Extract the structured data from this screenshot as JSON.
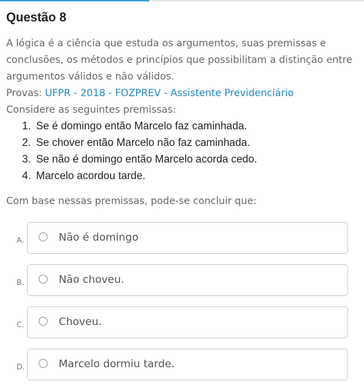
{
  "header": {
    "title": "Questão 8",
    "progress_fraction": 0.41
  },
  "question": {
    "intro": "A lógica é a ciência que estuda os argumentos, suas premissas e conclusões, os métodos e princípios que possibilitam a distinção entre argumentos válidos e não válidos.",
    "provas_label": "Provas:",
    "provas_link": "UFPR - 2018 - FOZPREV - Assistente Previdenciário",
    "consider": "Considere as seguintes premissas:",
    "premises": [
      {
        "num": "1.",
        "text": "Se é domingo então Marcelo faz caminhada."
      },
      {
        "num": "2.",
        "text": "Se chover então Marcelo não faz caminhada."
      },
      {
        "num": "3.",
        "text": "Se não é domingo então Marcelo acorda cedo."
      },
      {
        "num": "4.",
        "text": "Marcelo acordou tarde."
      }
    ],
    "prompt": "Com base nessas premissas, pode-se concluir que:"
  },
  "options": [
    {
      "letter": "A.",
      "text": "Não é domingo"
    },
    {
      "letter": "B.",
      "text": "Não choveu."
    },
    {
      "letter": "C.",
      "text": "Choveu."
    },
    {
      "letter": "D.",
      "text": "Marcelo dormiu tarde."
    }
  ],
  "colors": {
    "accent": "#1e88c8",
    "progress": "#3aa0d6",
    "border": "#cfcfcf"
  }
}
